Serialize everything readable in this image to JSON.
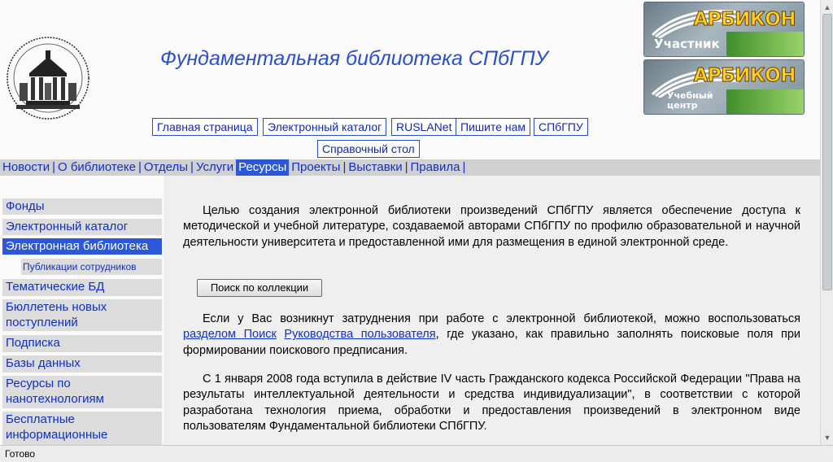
{
  "header": {
    "site_title": "Фундаментальная библиотека СПбГПУ",
    "top_buttons": [
      "Главная страница",
      "Электронный каталог",
      "RUSLANet",
      "Пишите нам",
      "СПбГПУ",
      "Справочный стол"
    ],
    "banners": [
      {
        "brand": "АРБИКОН",
        "label": "Участник"
      },
      {
        "brand": "АРБИКОН",
        "label_line1": "Учебный",
        "label_line2": "центр"
      }
    ]
  },
  "nav": {
    "items": [
      "Новости",
      "О библиотеке",
      "Отделы",
      "Услуги",
      "Ресурсы",
      "Проекты",
      "Выставки",
      "Правила"
    ],
    "active": "Ресурсы",
    "separator": "|"
  },
  "sidebar": {
    "items": [
      "Фонды",
      "Электронный каталог",
      "Электронная библиотека",
      "Публикации сотрудников",
      "Тематические БД",
      "Бюллетень новых поступлений",
      "Подписка",
      "Базы данных",
      "Ресурсы по нанотехнологиям",
      "Бесплатные информационные"
    ],
    "active": "Электронная библиотека"
  },
  "content": {
    "para1": "Целью создания электронной библиотеки произведений СПбГПУ является обеспечение доступа к методической и учебной литературе, создаваемой авторами СПбГПУ по профилю образовательной и научной деятельности университета и предоставленной ими для размещения в единой электронной среде.",
    "search_button": "Поиск по коллекции",
    "para2_start": "Если у Вас возникнут затруднения при работе с электронной библиотекой, можно воспользоваться ",
    "para2_link1": "разделом Поиск",
    "para2_link2": "Руководства пользователя",
    "para2_end": ", где указано, как правильно заполнять поисковые поля при формировании поискового предписания.",
    "para3": "С 1 января 2008 года вступила в действие IV часть Гражданского кодекса Российской Федерации \"Права на результаты интеллектуальной деятельности и средства индивидуализации\", в соответствии с которой разработана технология приема, обработки и предоставления произведений в электронном виде пользователям Фундаментальной библиотеки СПбГПУ."
  },
  "status": {
    "text": "Готово"
  },
  "colors": {
    "link": "#1030c8",
    "active_bg": "#2c58d8",
    "title": "#2a4fcc",
    "nav_bg": "#d0d0d0",
    "menu_bg": "#dcdcdc"
  }
}
